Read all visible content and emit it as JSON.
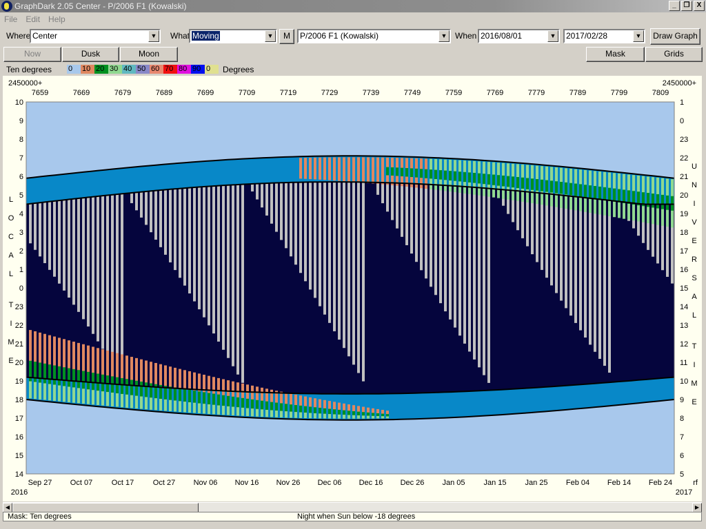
{
  "window": {
    "title": "GraphDark 2.05  Center  -  P/2006 F1 (Kowalski)",
    "btn_min": "_",
    "btn_restore": "❐",
    "btn_close": "X"
  },
  "menu": [
    "File",
    "Edit",
    "Help"
  ],
  "toolbar": {
    "where_label": "Where",
    "where_value": "Center",
    "what_label": "What",
    "what_value": "Moving",
    "m_button": "M",
    "object_value": "P/2006 F1 (Kowalski)",
    "when_label": "When",
    "start_date": "2016/08/01",
    "end_date": "2017/02/28",
    "draw_button": "Draw Graph"
  },
  "buttons": {
    "now": "Now",
    "dusk": "Dusk",
    "moon": "Moon",
    "mask": "Mask",
    "grids": "Grids"
  },
  "legend": {
    "title": "Ten degrees",
    "unit": "Degrees",
    "bands": [
      {
        "label": "0",
        "color": "#a8c8ec"
      },
      {
        "label": "10",
        "color": "#e08860"
      },
      {
        "label": "20",
        "color": "#009020"
      },
      {
        "label": "30",
        "color": "#90d890"
      },
      {
        "label": "40",
        "color": "#60b8c0"
      },
      {
        "label": "50",
        "color": "#8888c8"
      },
      {
        "label": "60",
        "color": "#e88870"
      },
      {
        "label": "70",
        "color": "#f01010"
      },
      {
        "label": "80",
        "color": "#e010e0"
      },
      {
        "label": "90",
        "color": "#0010f0"
      },
      {
        "label": "0",
        "color": "#e0e090"
      }
    ]
  },
  "chart_data": {
    "type": "heatmap",
    "jd_prefix": "2450000+",
    "jd_ticks": [
      "7659",
      "7669",
      "7679",
      "7689",
      "7699",
      "7709",
      "7719",
      "7729",
      "7739",
      "7749",
      "7759",
      "7769",
      "7779",
      "7789",
      "7799",
      "7809"
    ],
    "date_ticks": [
      "Sep 27",
      "Oct 07",
      "Oct 17",
      "Oct 27",
      "Nov 06",
      "Nov 16",
      "Nov 26",
      "Dec 06",
      "Dec 16",
      "Dec 26",
      "Jan 05",
      "Jan 15",
      "Jan 25",
      "Feb 04",
      "Feb 14",
      "Feb 24"
    ],
    "start_year": "2016",
    "end_year": "2017",
    "corner_label": "rf",
    "left_axis_ticks": [
      "10",
      "9",
      "8",
      "7",
      "6",
      "5",
      "4",
      "3",
      "2",
      "1",
      "0",
      "23",
      "22",
      "21",
      "20",
      "19",
      "18",
      "17",
      "16",
      "15",
      "14"
    ],
    "right_axis_ticks": [
      "1",
      "0",
      "23",
      "22",
      "21",
      "20",
      "19",
      "18",
      "17",
      "16",
      "15",
      "14",
      "13",
      "12",
      "11",
      "10",
      "9",
      "8",
      "7",
      "6",
      "5"
    ],
    "left_axis_title": "LOCAL TIME",
    "right_axis_title": "UNIVERSAL TIME",
    "colors": {
      "day_sky": "#a8c8ec",
      "night": "#05053d",
      "twilight": "#0888c8",
      "moon": "#c0c0c0",
      "outline": "#000000"
    }
  },
  "status": {
    "left": "Mask:  Ten degrees",
    "center": "Night when Sun below -18 degrees"
  }
}
